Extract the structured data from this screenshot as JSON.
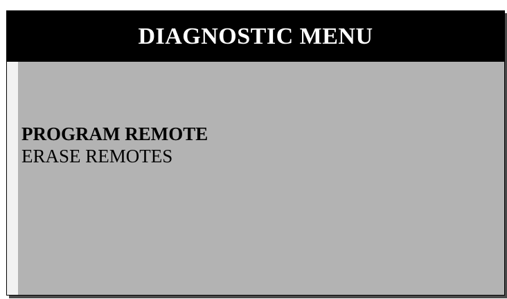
{
  "header": {
    "title": "DIAGNOSTIC MENU"
  },
  "menu": {
    "items": [
      {
        "label": "PROGRAM REMOTE",
        "selected": true
      },
      {
        "label": "ERASE REMOTES",
        "selected": false
      }
    ]
  },
  "colors": {
    "title_background": "#000000",
    "title_text": "#ffffff",
    "screen_background": "#b3b3b3",
    "left_strip": "#f2f2f2",
    "menu_text": "#000000"
  }
}
